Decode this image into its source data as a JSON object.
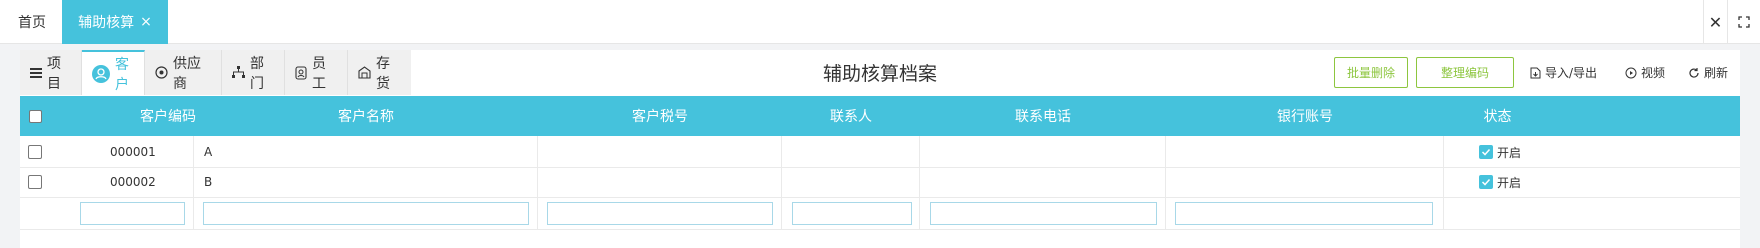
{
  "tabs": {
    "home": "首页",
    "active": "辅助核算",
    "close_glyph": "×"
  },
  "window": {
    "close_glyph": "✕"
  },
  "categories": [
    {
      "label": "项目",
      "icon": "list-icon"
    },
    {
      "label": "客户",
      "icon": "user-icon",
      "active": true
    },
    {
      "label": "供应商",
      "icon": "supplier-icon"
    },
    {
      "label": "部门",
      "icon": "department-icon"
    },
    {
      "label": "员工",
      "icon": "employee-icon"
    },
    {
      "label": "存货",
      "icon": "inventory-icon"
    }
  ],
  "page_title": "辅助核算档案",
  "toolbar": {
    "batch_delete": "批量删除",
    "organize_code": "整理编码",
    "import_export": "导入/导出",
    "video": "视频",
    "refresh": "刷新"
  },
  "table": {
    "headers": [
      "客户编码",
      "客户名称",
      "客户税号",
      "联系人",
      "联系电话",
      "银行账号",
      "状态"
    ],
    "rows": [
      {
        "code": "000001",
        "name": "A",
        "tax": "",
        "contact": "",
        "phone": "",
        "bank": "",
        "status": "开启"
      },
      {
        "code": "000002",
        "name": "B",
        "tax": "",
        "contact": "",
        "phone": "",
        "bank": "",
        "status": "开启"
      }
    ]
  },
  "colors": {
    "accent": "#45c2dc",
    "green": "#8dc63f"
  }
}
